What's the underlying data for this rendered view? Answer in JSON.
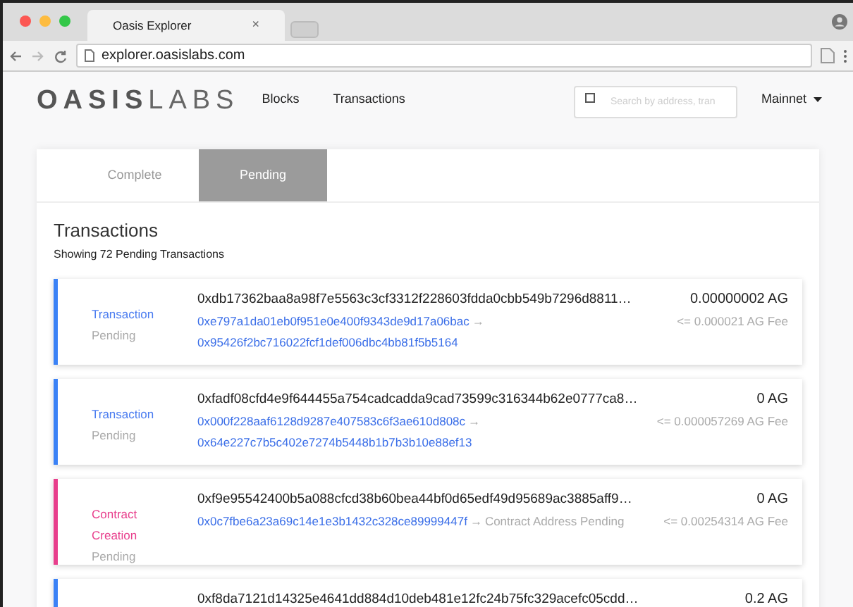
{
  "browser": {
    "tab_title": "Oasis Explorer",
    "tab_close": "×",
    "address": "explorer.oasislabs.com"
  },
  "nav": {
    "logo_bold": "OASIS",
    "logo_light": "LABS",
    "links": [
      "Blocks",
      "Transactions"
    ],
    "search_placeholder": "Search by address, tran",
    "network": "Mainnet"
  },
  "tabs": [
    {
      "label": "Complete",
      "selected": false
    },
    {
      "label": "Pending",
      "selected": true
    }
  ],
  "section": {
    "title": "Transactions",
    "subtitle": "Showing 72 Pending Transactions"
  },
  "transactions": [
    {
      "kind": "transaction",
      "type_lines": [
        "Transaction"
      ],
      "status": "Pending",
      "hash": "0xdb17362baa8a98f7e5563c3cf3312f228603fdda0cbb549b7296d8811…",
      "from": "0xe797a1da01eb0f951e0e400f9343de9d17a06bac",
      "arrow": "→",
      "to": "0x95426f2bc716022fcf1def006dbc4bb81f5b5164",
      "amount": "0.00000002 AG",
      "fee": "<= 0.000021 AG Fee"
    },
    {
      "kind": "transaction",
      "type_lines": [
        "Transaction"
      ],
      "status": "Pending",
      "hash": "0xfadf08cfd4e9f644455a754cadcadda9cad73599c316344b62e0777ca8…",
      "from": "0x000f228aaf6128d9287e407583c6f3ae610d808c",
      "arrow": "→",
      "to": "0x64e227c7b5c402e7274b5448b1b7b3b10e88ef13",
      "amount": "0 AG",
      "fee": "<= 0.000057269 AG Fee"
    },
    {
      "kind": "contract",
      "type_lines": [
        "Contract",
        "Creation"
      ],
      "status": "Pending",
      "hash": "0xf9e95542400b5a088cfcd38b60bea44bf0d65edf49d95689ac3885aff9…",
      "from": "0x0c7fbe6a23a69c14e1e3b1432c328ce89999447f",
      "arrow": "→",
      "to_note": "Contract Address Pending",
      "amount": "0 AG",
      "fee": "<= 0.00254314 AG Fee"
    },
    {
      "kind": "transaction",
      "hash": "0xf8da7121d14325e4641dd884d10deb481e12fc24b75fc329acefc05cdd…",
      "amount": "0.2 AG"
    }
  ]
}
